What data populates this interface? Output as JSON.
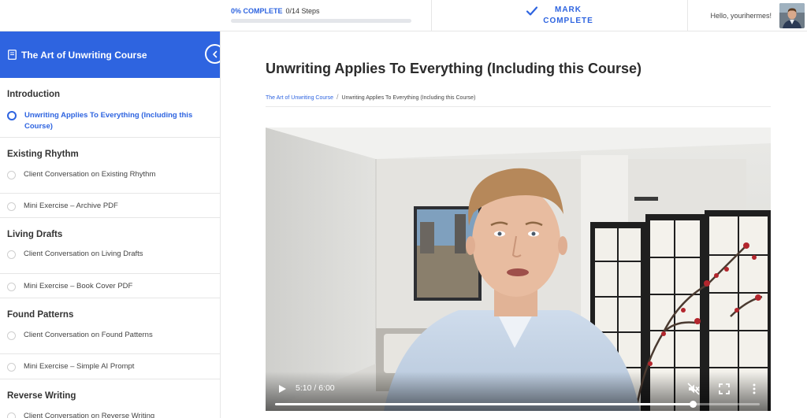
{
  "topbar": {
    "progress_percent_label": "0% COMPLETE",
    "steps_label": "0/14 Steps",
    "progress_fraction": 0,
    "mark_complete_label": "MARK COMPLETE",
    "greeting": "Hello, yourihermes!"
  },
  "sidebar": {
    "course_title": "The Art of Unwriting Course",
    "sections": [
      {
        "title": "Introduction",
        "lessons": [
          {
            "label": "Unwriting Applies To Everything (Including this Course)",
            "active": true
          }
        ]
      },
      {
        "title": "Existing Rhythm",
        "lessons": [
          {
            "label": "Client Conversation on Existing Rhythm"
          },
          {
            "label": "Mini Exercise – Archive PDF"
          }
        ]
      },
      {
        "title": "Living Drafts",
        "lessons": [
          {
            "label": "Client Conversation on Living Drafts"
          },
          {
            "label": "Mini Exercise – Book Cover PDF"
          }
        ]
      },
      {
        "title": "Found Patterns",
        "lessons": [
          {
            "label": "Client Conversation on Found Patterns"
          },
          {
            "label": "Mini Exercise – Simple AI Prompt"
          }
        ]
      },
      {
        "title": "Reverse Writing",
        "lessons": [
          {
            "label": "Client Conversation on Reverse Writing"
          }
        ]
      }
    ]
  },
  "main": {
    "title": "Unwriting Applies To Everything (Including this Course)",
    "breadcrumb": {
      "course": "The Art of Unwriting Course",
      "separator": "/",
      "current": "Unwriting Applies To Everything (Including this Course)"
    }
  },
  "video": {
    "time_label": "5:10 / 6:00",
    "played_fraction": 0.861,
    "icons": [
      "play-icon",
      "mute-icon",
      "fullscreen-icon",
      "more-options-icon"
    ]
  },
  "colors": {
    "accent": "#2e64e0",
    "text": "#333333",
    "border": "#e6e6e6"
  }
}
